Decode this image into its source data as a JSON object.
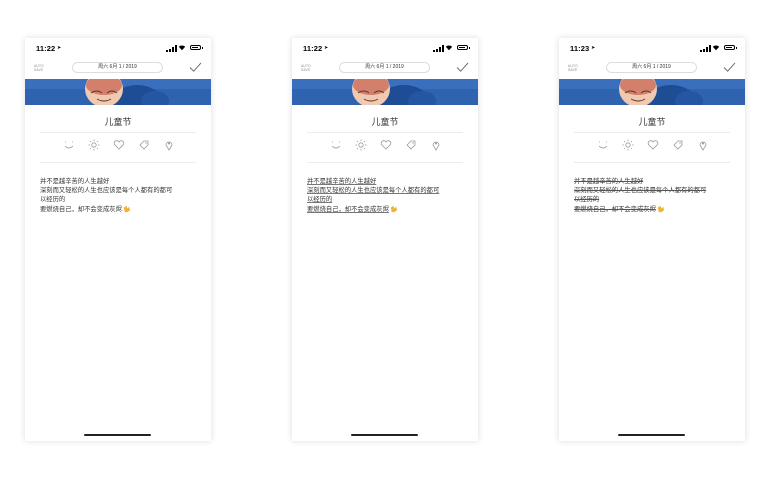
{
  "screens": [
    {
      "time": "11:22",
      "autosave": [
        "AUTO",
        "SAVE"
      ],
      "date": "周六 6月 1 / 2019",
      "title": "儿童节",
      "lines": [
        "并不是越辛苦的人生越好",
        "深刻而又轻松的人生也应该是每个人都有的都可",
        "以经历的",
        "要燃烧自己，却不会变成灰烬"
      ],
      "text_style": "plain"
    },
    {
      "time": "11:22",
      "autosave": [
        "AUTO",
        "SAVE"
      ],
      "date": "周六 6月 1 / 2019",
      "title": "儿童节",
      "lines": [
        "并不是越辛苦的人生越好",
        "深刻而又轻松的人生也应该是每个人都有的都可",
        "以经历的",
        "要燃烧自己，却不会变成灰烬"
      ],
      "text_style": "underline"
    },
    {
      "time": "11:23",
      "autosave": [
        "AUTO",
        "SAVE"
      ],
      "date": "周六 6月 1 / 2019",
      "title": "儿童节",
      "lines": [
        "并不是越辛苦的人生越好",
        "深刻而又轻松的人生也应该是每个人都有的都可",
        "以经历的",
        "要燃烧自己，却不会变成灰烬"
      ],
      "text_style": "strikethrough"
    }
  ],
  "toolbar_icons": [
    "mood-icon",
    "weather-sun-icon",
    "heart-icon",
    "tag-icon",
    "location-pin-icon"
  ],
  "colors": {
    "banner": "#2d5faa",
    "divider": "#ececec",
    "text": "#333333"
  }
}
